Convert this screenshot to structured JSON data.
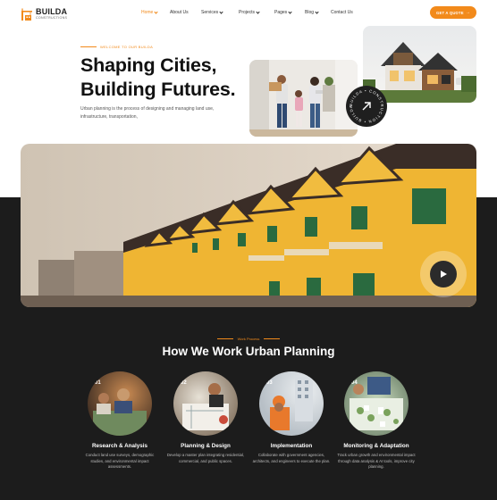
{
  "brand": {
    "name": "BUILDA",
    "tagline": "CONSTRUCTIONS",
    "accent": "#f28a1b"
  },
  "nav": {
    "items": [
      {
        "label": "Home",
        "dropdown": true,
        "active": true
      },
      {
        "label": "About Us",
        "dropdown": false,
        "active": false
      },
      {
        "label": "Services",
        "dropdown": true,
        "active": false
      },
      {
        "label": "Projects",
        "dropdown": true,
        "active": false
      },
      {
        "label": "Pages",
        "dropdown": true,
        "active": false
      },
      {
        "label": "Blog",
        "dropdown": true,
        "active": false
      },
      {
        "label": "Contact Us",
        "dropdown": false,
        "active": false
      }
    ],
    "cta_label": "GET A QUOTE"
  },
  "hero": {
    "eyebrow": "WELCOME TO OUR BUILDA",
    "title_line1": "Shaping Cities,",
    "title_line2": "Building Futures.",
    "description": "Urban planning is the process of designing and managing land use, infrastructure, transportation,",
    "badge_text": "BUILDA • CONSTRUCTION • BUILDA •"
  },
  "process": {
    "eyebrow": "Work Process",
    "title": "How We Work Urban Planning",
    "steps": [
      {
        "num": "01",
        "title": "Research & Analysis",
        "desc": "Conduct land use surveys, demographic studies, and environmental impact assessments."
      },
      {
        "num": "02",
        "title": "Planning & Design",
        "desc": "Develop a master plan integrating residential, commercial, and public spaces."
      },
      {
        "num": "03",
        "title": "Implementation",
        "desc": "Collaborate with government agencies, architects, and engineers to execute the plan."
      },
      {
        "num": "04",
        "title": "Monitoring & Adaptation",
        "desc": "Track urban growth and environmental impact through data analysis & AI tools, improve city planning."
      }
    ]
  },
  "icons": {
    "play": "play-icon",
    "arrow": "arrow-up-right-icon",
    "chevron": "chevron-down-icon"
  }
}
